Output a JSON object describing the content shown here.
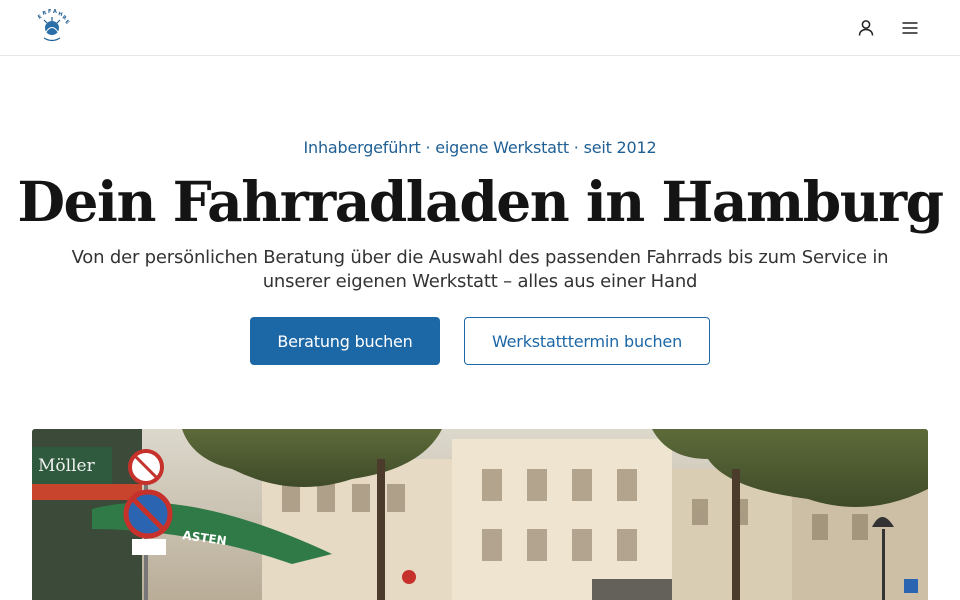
{
  "header": {
    "logo_text": "ERFAHRE · RAD FÜR",
    "account_icon": "user-icon",
    "menu_icon": "hamburger-menu-icon"
  },
  "hero": {
    "eyebrow": "Inhabergeführt · eigene Werkstatt · seit 2012",
    "title": "Dein Fahrradladen in Hamburg",
    "lead": "Von der persönlichen Beratung über die Auswahl des passenden Fahrrads bis zum Service in unserer eigenen Werkstatt – alles aus einer Hand",
    "primary_button": "Beratung buchen",
    "secondary_button": "Werkstatttermin buchen"
  },
  "photo": {
    "shop_sign": "Möller",
    "umbrella_text": "ASTEN"
  },
  "colors": {
    "accent": "#1c67a6",
    "text": "#141414"
  }
}
